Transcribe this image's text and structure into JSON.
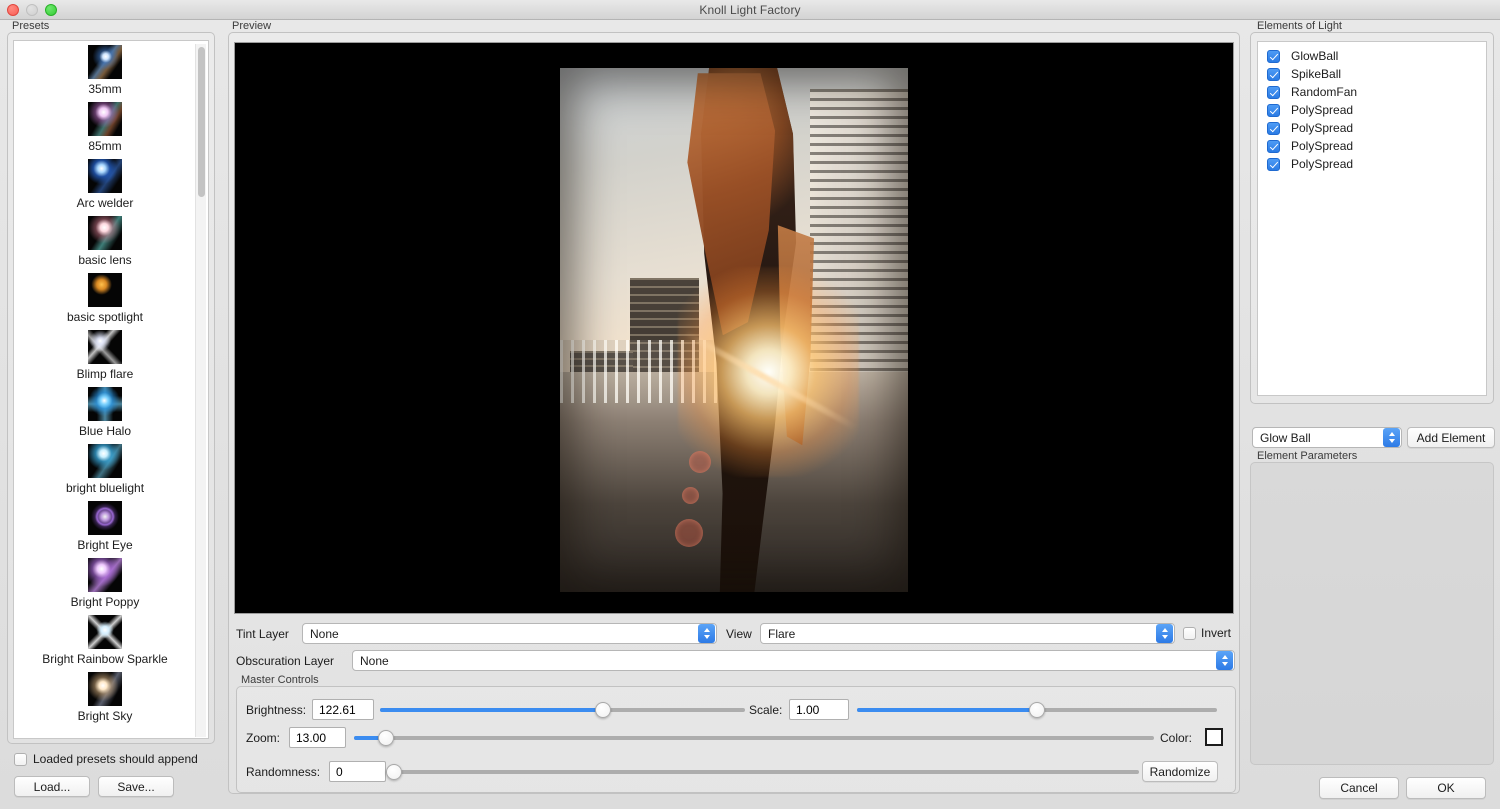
{
  "window": {
    "title": "Knoll Light Factory",
    "traffic_lights": [
      "close",
      "minimize",
      "zoom"
    ]
  },
  "presets": {
    "label": "Presets",
    "items": [
      {
        "name": "35mm"
      },
      {
        "name": "85mm"
      },
      {
        "name": "Arc welder"
      },
      {
        "name": "basic lens"
      },
      {
        "name": "basic spotlight"
      },
      {
        "name": "Blimp flare"
      },
      {
        "name": "Blue Halo"
      },
      {
        "name": "bright bluelight"
      },
      {
        "name": "Bright Eye"
      },
      {
        "name": "Bright Poppy"
      },
      {
        "name": "Bright Rainbow Sparkle"
      },
      {
        "name": "Bright Sky"
      }
    ],
    "append_checkbox": {
      "label": "Loaded presets should append",
      "checked": false
    },
    "load_button": "Load...",
    "save_button": "Save..."
  },
  "preview": {
    "label": "Preview",
    "tint_layer": {
      "label": "Tint Layer",
      "value": "None"
    },
    "view": {
      "label": "View",
      "value": "Flare"
    },
    "invert": {
      "label": "Invert",
      "checked": false
    },
    "obscuration_layer": {
      "label": "Obscuration Layer",
      "value": "None"
    }
  },
  "master_controls": {
    "label": "Master Controls",
    "brightness": {
      "label": "Brightness:",
      "value": "122.61",
      "percent": 61
    },
    "scale": {
      "label": "Scale:",
      "value": "1.00",
      "percent": 50
    },
    "zoom": {
      "label": "Zoom:",
      "value": "13.00",
      "percent": 4
    },
    "color": {
      "label": "Color:",
      "value": "#ffffff"
    },
    "randomness": {
      "label": "Randomness:",
      "value": "0",
      "percent": 0
    },
    "randomize_button": "Randomize"
  },
  "elements_of_light": {
    "label": "Elements of Light",
    "items": [
      {
        "name": "GlowBall",
        "checked": true
      },
      {
        "name": "SpikeBall",
        "checked": true
      },
      {
        "name": "RandomFan",
        "checked": true
      },
      {
        "name": "PolySpread",
        "checked": true
      },
      {
        "name": "PolySpread",
        "checked": true
      },
      {
        "name": "PolySpread",
        "checked": true
      },
      {
        "name": "PolySpread",
        "checked": true
      }
    ],
    "type_selector": {
      "value": "Glow Ball"
    },
    "add_element_button": "Add Element",
    "element_parameters_label": "Element Parameters"
  },
  "footer": {
    "cancel_button": "Cancel",
    "ok_button": "OK"
  },
  "colors": {
    "accent_blue": "#3b8cf0",
    "window_bg": "#dcdcdc",
    "canvas_bg": "#000000"
  }
}
